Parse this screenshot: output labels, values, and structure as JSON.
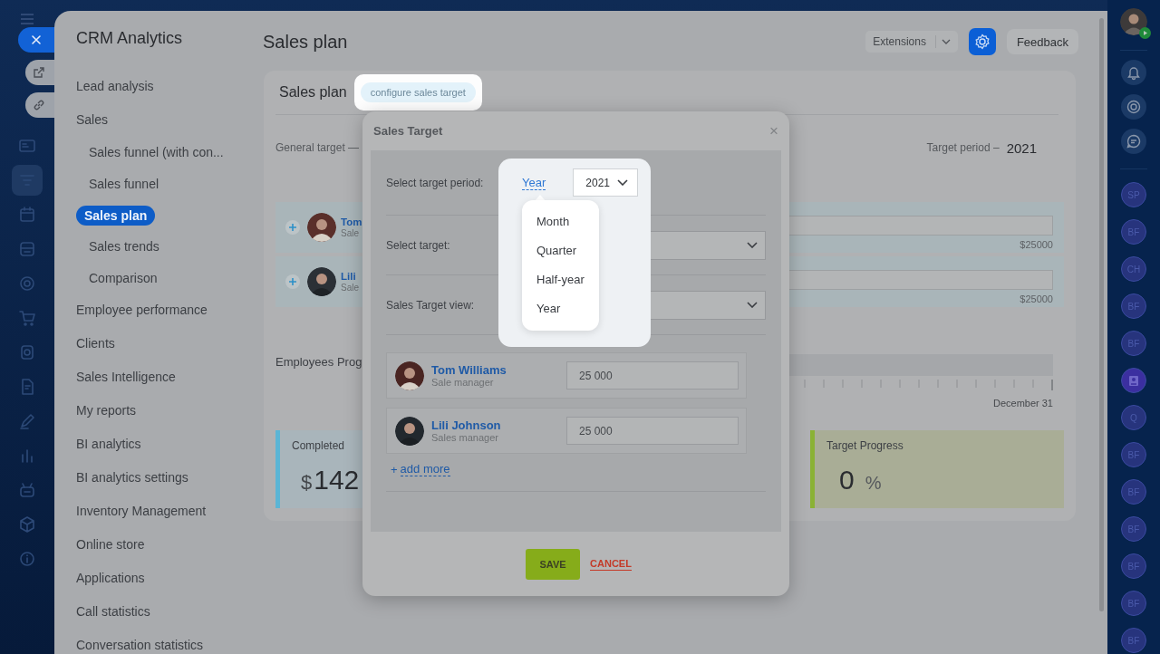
{
  "left_rail": {
    "actions": [
      {
        "kind": "close"
      },
      {
        "kind": "open"
      },
      {
        "kind": "link"
      }
    ],
    "items": [
      {
        "kind": "card",
        "selected": false
      },
      {
        "kind": "filter",
        "selected": true
      },
      {
        "kind": "calendar",
        "selected": false
      },
      {
        "kind": "inbox",
        "selected": false
      },
      {
        "kind": "target",
        "selected": false
      },
      {
        "kind": "cart",
        "selected": false
      },
      {
        "kind": "device",
        "selected": false
      },
      {
        "kind": "document",
        "selected": false
      },
      {
        "kind": "pen",
        "selected": false
      },
      {
        "kind": "chart",
        "selected": false
      },
      {
        "kind": "robot",
        "selected": false
      },
      {
        "kind": "cube",
        "selected": false
      },
      {
        "kind": "info",
        "selected": false
      }
    ]
  },
  "sidebar": {
    "title": "CRM Analytics",
    "items": [
      {
        "label": "Lead analysis",
        "selected": false
      },
      {
        "label": "Sales",
        "selected": false,
        "children": [
          {
            "label": "Sales funnel (with con...",
            "selected": false
          },
          {
            "label": "Sales funnel",
            "selected": false
          },
          {
            "label": "Sales plan",
            "selected": true
          },
          {
            "label": "Sales trends",
            "selected": false
          },
          {
            "label": "Comparison",
            "selected": false
          }
        ]
      },
      {
        "label": "Employee performance",
        "selected": false
      },
      {
        "label": "Clients",
        "selected": false
      },
      {
        "label": "Sales Intelligence",
        "selected": false
      },
      {
        "label": "My reports",
        "selected": false
      },
      {
        "label": "BI analytics",
        "selected": false
      },
      {
        "label": "BI analytics settings",
        "selected": false
      },
      {
        "label": "Inventory Management",
        "selected": false
      },
      {
        "label": "Online store",
        "selected": false
      },
      {
        "label": "Applications",
        "selected": false
      },
      {
        "label": "Call statistics",
        "selected": false
      },
      {
        "label": "Conversation statistics",
        "selected": false
      }
    ]
  },
  "header": {
    "title": "Sales plan",
    "buttons": [
      {
        "kind": "dropdown",
        "label": "Extensions"
      },
      {
        "kind": "settings"
      },
      {
        "kind": "text",
        "label": "Feedback"
      }
    ]
  },
  "card": {
    "title": "Sales plan",
    "configure": {
      "label": "configure sales target",
      "highlighted": true
    },
    "general_target": "General target  —",
    "period_label": "Target period  –",
    "period_value": "2021",
    "employees": [
      {
        "name": "Tom",
        "role": "Sale",
        "amount": "$25000"
      },
      {
        "name": "Lili",
        "role": "Sale",
        "amount": "$25000"
      }
    ],
    "progress": {
      "label": "Employees Prog",
      "end_label": "December 31"
    },
    "stats": [
      {
        "kind": "completed",
        "label": "Completed",
        "currency": "$",
        "value": "142"
      },
      {
        "kind": "target",
        "label": "Target Progress",
        "value": "0",
        "unit": "%"
      }
    ]
  },
  "modal": {
    "title": "Sales Target",
    "close": "×",
    "period": {
      "label": "Select target period:",
      "type": "Year",
      "year": "2021",
      "highlighted": true,
      "menu": [
        {
          "label": "Month",
          "selected": false
        },
        {
          "label": "Quarter",
          "selected": false
        },
        {
          "label": "Half-year",
          "selected": false
        },
        {
          "label": "Year",
          "selected": false
        }
      ]
    },
    "target_label": "Select target:",
    "view_label": "Sales Target view:",
    "employees": [
      {
        "name": "Tom Williams",
        "role": "Sale manager",
        "amount": "25 000"
      },
      {
        "name": "Lili Johnson",
        "role": "Sales manager",
        "amount": "25 000"
      }
    ],
    "add_plus": "+",
    "add_more": "add more",
    "save": "SAVE",
    "cancel": "CANCEL"
  },
  "right_rail": {
    "items": [
      {
        "kind": "initials",
        "text": "SP"
      },
      {
        "kind": "initials",
        "text": "BF"
      },
      {
        "kind": "initials",
        "text": "CH"
      },
      {
        "kind": "initials",
        "text": "BF"
      },
      {
        "kind": "initials",
        "text": "BF"
      },
      {
        "kind": "contacts"
      },
      {
        "kind": "initials",
        "text": "Q"
      },
      {
        "kind": "initials",
        "text": "BF"
      },
      {
        "kind": "initials",
        "text": "BF"
      },
      {
        "kind": "initials",
        "text": "BF"
      },
      {
        "kind": "initials",
        "text": "BF"
      },
      {
        "kind": "initials",
        "text": "BF"
      },
      {
        "kind": "initials",
        "text": "BF"
      }
    ]
  }
}
